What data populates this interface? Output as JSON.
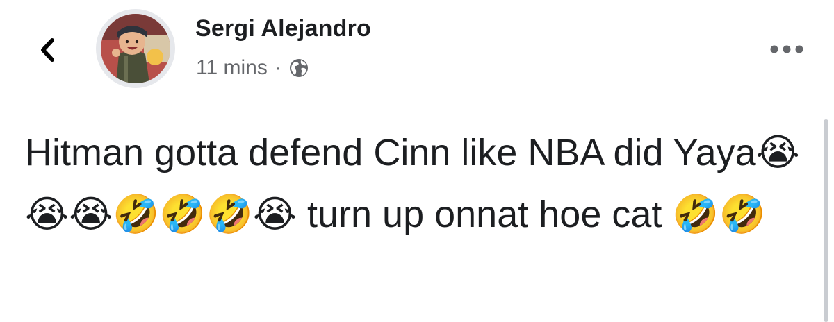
{
  "header": {
    "back_icon": "chevron-left-icon",
    "author_name": "Sergi Alejandro",
    "timestamp": "11 mins",
    "separator": "·",
    "privacy_icon": "globe-icon",
    "more_icon": "more-horizontal-icon"
  },
  "post": {
    "text": "Hitman gotta defend Cinn like NBA did Yaya😭😭😭🤣🤣🤣😭 turn up onnat hoe cat 🤣🤣"
  },
  "colors": {
    "name_text": "#1c1e21",
    "meta_text": "#65676b",
    "avatar_ring": "#e6e8ec",
    "scrollbar": "#c9ccd1"
  }
}
